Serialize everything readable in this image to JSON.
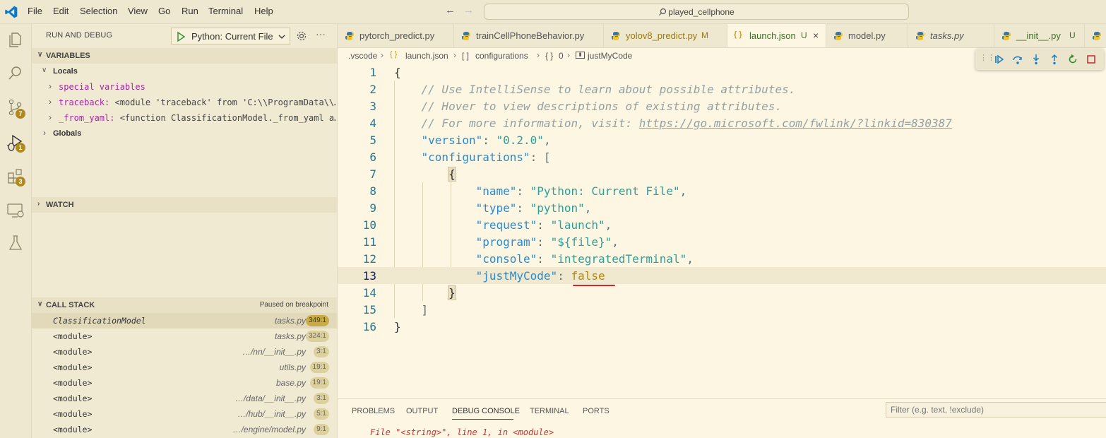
{
  "titlebar": {
    "menus": [
      "File",
      "Edit",
      "Selection",
      "View",
      "Go",
      "Run",
      "Terminal",
      "Help"
    ],
    "search_text": "played_cellphone"
  },
  "activity": {
    "scm_badge": "7",
    "debug_badge": "1",
    "extensions_badge": "3"
  },
  "sidebar": {
    "title": "RUN AND DEBUG",
    "config_name": "Python: Current File",
    "variables_header": "VARIABLES",
    "locals_label": "Locals",
    "locals": [
      {
        "name": "special variables",
        "value": ""
      },
      {
        "name": "traceback:",
        "value": " <module 'traceback' from 'C:\\\\ProgramData\\\\…"
      },
      {
        "name": "_from_yaml:",
        "value": " <function ClassificationModel._from_yaml a…"
      }
    ],
    "globals_label": "Globals",
    "watch_header": "WATCH",
    "callstack_header": "CALL STACK",
    "callstack_status": "Paused on breakpoint",
    "callstack": [
      {
        "fn": "ClassificationModel",
        "file": "tasks.py",
        "line": "349:1"
      },
      {
        "fn": "<module>",
        "file": "tasks.py",
        "line": "324:1"
      },
      {
        "fn": "<module>",
        "file": "…/nn/__init__.py",
        "line": "3:1"
      },
      {
        "fn": "<module>",
        "file": "utils.py",
        "line": "19:1"
      },
      {
        "fn": "<module>",
        "file": "base.py",
        "line": "19:1"
      },
      {
        "fn": "<module>",
        "file": "…/data/__init__.py",
        "line": "3:1"
      },
      {
        "fn": "<module>",
        "file": "…/hub/__init__.py",
        "line": "5:1"
      },
      {
        "fn": "<module>",
        "file": "…/engine/model.py",
        "line": "9:1"
      }
    ]
  },
  "tabs": [
    {
      "label": "pytorch_predict.py",
      "status": "",
      "icon": "python-icon"
    },
    {
      "label": "trainCellPhoneBehavior.py",
      "status": "",
      "icon": "python-icon"
    },
    {
      "label": "yolov8_predict.py",
      "status": "M",
      "icon": "python-icon"
    },
    {
      "label": "launch.json",
      "status": "U",
      "icon": "json-icon"
    },
    {
      "label": "model.py",
      "status": "",
      "icon": "python-icon"
    },
    {
      "label": "tasks.py",
      "status": "",
      "icon": "python-icon"
    },
    {
      "label": "__init__.py",
      "status": "U",
      "icon": "python-icon"
    }
  ],
  "breadcrumbs": [
    ".vscode",
    "launch.json",
    "configurations",
    "0",
    "justMyCode"
  ],
  "code": {
    "line_numbers": [
      "1",
      "2",
      "3",
      "4",
      "5",
      "6",
      "7",
      "8",
      "9",
      "10",
      "11",
      "12",
      "13",
      "14",
      "15",
      "16"
    ],
    "l1": "{",
    "l2": "// Use IntelliSense to learn about possible attributes.",
    "l3": "// Hover to view descriptions of existing attributes.",
    "l4_prefix": "// For more information, visit: ",
    "l4_url": "https://go.microsoft.com/fwlink/?linkid=830387",
    "l5_key": "\"version\"",
    "l5_val": "\"0.2.0\"",
    "l6_key": "\"configurations\"",
    "l6_rest": ": [",
    "l7": "{",
    "l8_key": "\"name\"",
    "l8_val": "\"Python: Current File\"",
    "l9_key": "\"type\"",
    "l9_val": "\"python\"",
    "l10_key": "\"request\"",
    "l10_val": "\"launch\"",
    "l11_key": "\"program\"",
    "l11_val": "\"${file}\"",
    "l12_key": "\"console\"",
    "l12_val": "\"integratedTerminal\"",
    "l13_key": "\"justMyCode\"",
    "l13_val": "false",
    "l14": "}",
    "l15": "]",
    "l16": "}"
  },
  "panel": {
    "tabs": [
      "PROBLEMS",
      "OUTPUT",
      "DEBUG CONSOLE",
      "TERMINAL",
      "PORTS"
    ],
    "active_tab": "DEBUG CONSOLE",
    "filter_placeholder": "Filter (e.g. text, !exclude)",
    "output_line": "File \"<string>\", line 1, in <module>"
  },
  "colors": {
    "accent_red": "#dd2222",
    "badge": "#b08a1e",
    "python_blue": "#3776ab",
    "json_yellow": "#cbcb41"
  }
}
